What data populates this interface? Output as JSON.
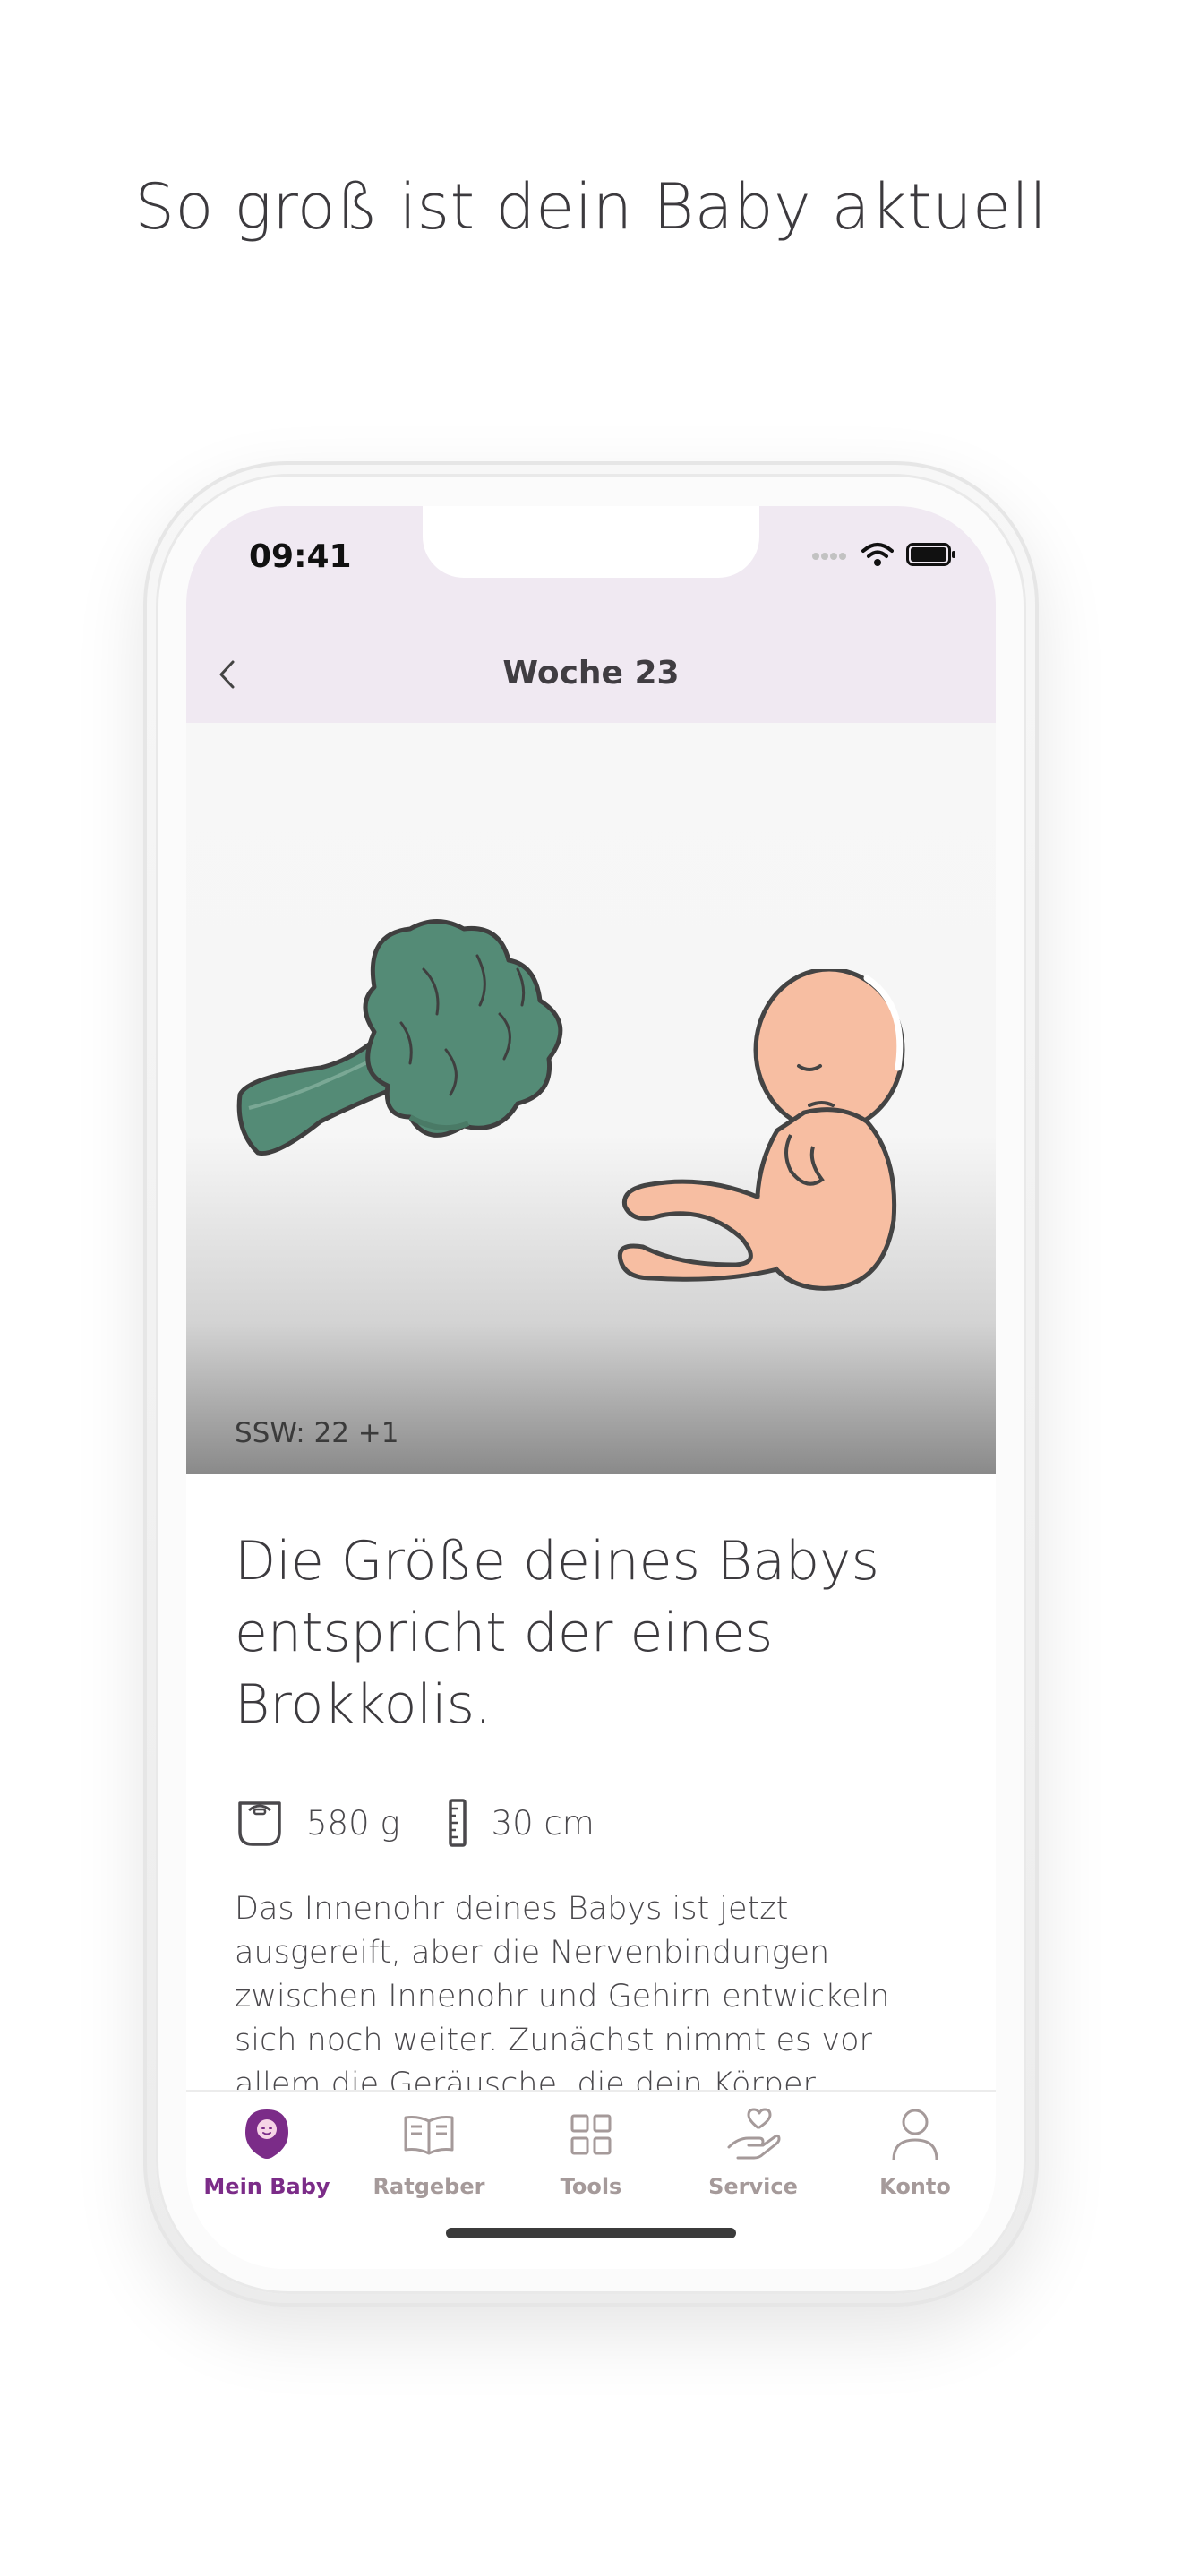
{
  "headline": "So groß ist dein Baby aktuell",
  "status_bar": {
    "time": "09:41"
  },
  "nav": {
    "title": "Woche 23",
    "back_icon": "chevron-left-icon"
  },
  "hero": {
    "ssw_label": "SSW: 22 +1",
    "illustrations": [
      "broccoli",
      "fetus"
    ]
  },
  "content": {
    "size_title": "Die Größe deines Babys entspricht der eines Brokkolis.",
    "weight": "580 g",
    "length": "30 cm",
    "description": "Das Innenohr deines Babys ist jetzt ausgereift, aber die Nervenbindungen zwischen Innenohr und Gehirn entwickeln sich noch weiter. Zunächst nimmt es vor allem die Geräusche, die dein Körper verursacht, wahr –zum Beispiel deinen Herzschlag, den gluckernden Magen"
  },
  "tabs": [
    {
      "label": "Mein Baby",
      "icon": "baby-icon",
      "active": true
    },
    {
      "label": "Ratgeber",
      "icon": "book-icon",
      "active": false
    },
    {
      "label": "Tools",
      "icon": "grid-icon",
      "active": false
    },
    {
      "label": "Service",
      "icon": "heart-hand-icon",
      "active": false
    },
    {
      "label": "Konto",
      "icon": "person-icon",
      "active": false
    }
  ],
  "colors": {
    "accent": "#7b2c88",
    "header_bg": "#f0e9f2",
    "broccoli": "#548b76",
    "skin": "#f7bea2",
    "tab_inactive": "#a59a9a"
  }
}
